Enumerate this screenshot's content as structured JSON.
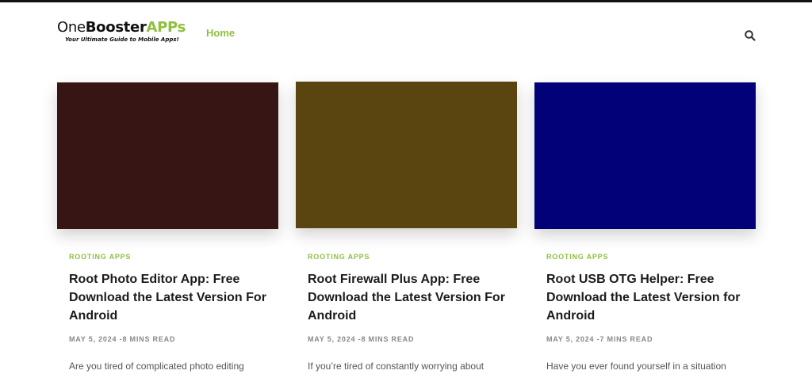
{
  "site": {
    "logo_part1": "One",
    "logo_part2": "Booster",
    "logo_part3": "APPs",
    "tagline": "Your Ultimate Guide to Mobile Apps!",
    "accent_color": "#8fbf3f"
  },
  "nav": {
    "home_label": "Home",
    "search_icon": "search-icon"
  },
  "posts": [
    {
      "category": "ROOTING APPS",
      "title": "Root Photo Editor App: Free Download the Latest Version For Android",
      "date": "MAY 5, 2024",
      "read_time": "8 MINS READ",
      "excerpt": "Are you tired of complicated photo editing",
      "image_color": "#361514"
    },
    {
      "category": "ROOTING APPS",
      "title": "Root Firewall Plus App: Free Download the Latest Version For Android",
      "date": "MAY 5, 2024",
      "read_time": "8 MINS READ",
      "excerpt": "If you’re tired of constantly worrying about",
      "image_color": "#5a440f"
    },
    {
      "category": "ROOTING APPS",
      "title": "Root USB OTG Helper: Free Download the Latest Version for Android",
      "date": "MAY 5, 2024",
      "read_time": "7 MINS READ",
      "excerpt": "Have you ever found yourself in a situation",
      "image_color": "#020177"
    }
  ]
}
